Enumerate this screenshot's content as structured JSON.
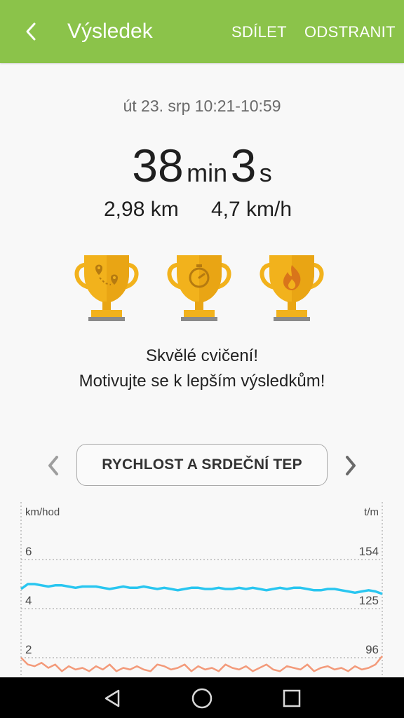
{
  "header": {
    "title": "Výsledek",
    "share": "SDÍLET",
    "delete": "ODSTRANIT"
  },
  "workout": {
    "date_range": "út 23. srp 10:21-10:59",
    "minutes": "38",
    "min_unit": "min",
    "seconds": "3",
    "sec_unit": "s",
    "distance": "2,98 km",
    "speed": "4,7 km/h"
  },
  "trophies": [
    "route-trophy-icon",
    "stopwatch-trophy-icon",
    "flame-trophy-icon"
  ],
  "message": {
    "line1": "Skvělé cvičení!",
    "line2": "Motivujte se k lepším výsledkům!"
  },
  "chart_selector": {
    "label": "RYCHLOST A SRDEČNÍ TEP"
  },
  "colors": {
    "accent": "#8bc34a",
    "speed_line": "#29c6f0",
    "heart_line": "#f39a7a",
    "trophy": "#f2b21c"
  },
  "chart_data": {
    "type": "line",
    "y_left_label": "km/hod",
    "y_right_label": "t/m",
    "y_left_ticks": [
      "6",
      "4",
      "2"
    ],
    "y_right_ticks": [
      "154",
      "125",
      "96"
    ],
    "ylim_left": [
      2,
      6
    ],
    "ylim_right": [
      96,
      154
    ],
    "grid": true,
    "series": [
      {
        "color": "#29c6f0",
        "values": [
          4.8,
          5.0,
          5.0,
          4.95,
          4.9,
          4.95,
          4.95,
          4.9,
          4.85,
          4.9,
          4.9,
          4.9,
          4.85,
          4.8,
          4.85,
          4.9,
          4.85,
          4.85,
          4.9,
          4.85,
          4.8,
          4.85,
          4.8,
          4.75,
          4.8,
          4.85,
          4.85,
          4.8,
          4.8,
          4.85,
          4.8,
          4.8,
          4.85,
          4.8,
          4.85,
          4.8,
          4.75,
          4.8,
          4.85,
          4.8,
          4.85,
          4.85,
          4.8,
          4.75,
          4.75,
          4.8,
          4.8,
          4.75,
          4.7,
          4.65,
          4.7,
          4.75,
          4.7,
          4.6
        ]
      },
      {
        "color": "#f39a7a",
        "values": [
          96,
          92,
          91,
          93,
          90,
          92,
          88,
          91,
          89,
          90,
          88,
          91,
          89,
          92,
          88,
          90,
          89,
          91,
          89,
          88,
          92,
          91,
          89,
          90,
          92,
          88,
          91,
          89,
          90,
          88,
          92,
          90,
          89,
          91,
          88,
          90,
          92,
          89,
          88,
          91,
          90,
          89,
          92,
          88,
          90,
          91,
          89,
          90,
          88,
          91,
          89,
          90,
          92,
          97
        ]
      }
    ]
  }
}
